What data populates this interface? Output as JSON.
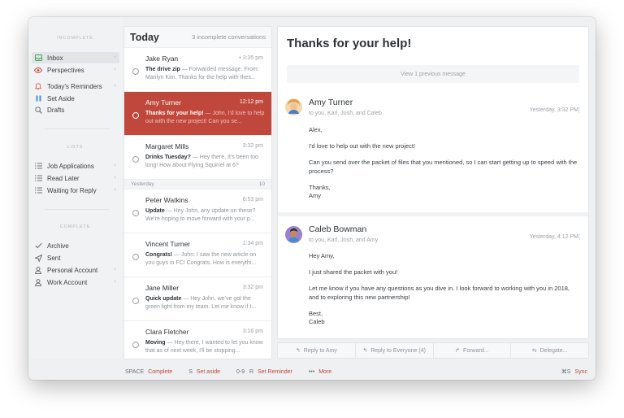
{
  "sidebar": {
    "sections": [
      "INCOMPLETE",
      "LISTS",
      "COMPLETE"
    ],
    "incomplete": [
      {
        "label": "Inbox",
        "icon": "inbox-icon",
        "color": "#45a35a"
      },
      {
        "label": "Perspectives",
        "icon": "eye-icon",
        "color": "#c0473b"
      },
      {
        "label": "Today's Reminders",
        "icon": "bell-icon",
        "color": "#e06a5c"
      },
      {
        "label": "Set Aside",
        "icon": "pause-icon",
        "color": "#4a8fd6"
      },
      {
        "label": "Drafts",
        "icon": "drafts-icon",
        "color": "#6b7076"
      }
    ],
    "lists": [
      {
        "label": "Job Applications",
        "icon": "list-icon"
      },
      {
        "label": "Read Later",
        "icon": "list-icon"
      },
      {
        "label": "Waiting for Reply",
        "icon": "list-icon"
      }
    ],
    "complete": [
      {
        "label": "Archive",
        "icon": "check-icon"
      },
      {
        "label": "Sent",
        "icon": "send-icon"
      },
      {
        "label": "Personal Account",
        "icon": "user-icon"
      },
      {
        "label": "Work Account",
        "icon": "user-icon"
      }
    ]
  },
  "list": {
    "title": "Today",
    "count_label": "3 incomplete conversations",
    "yesterday_label": "Yesterday",
    "yesterday_count": "10",
    "today": [
      {
        "sender": "Jake Ryan",
        "time": "3:35 pm",
        "subject": "The drive zip",
        "preview": " — Forwarded message. From: Marilyn Kim. Thanks for the help with thes..."
      },
      {
        "sender": "Amy Turner",
        "time": "12:12 pm",
        "subject": "Thanks for your help!",
        "preview": " — John, I'd love to help out with the new project! Can you se..."
      },
      {
        "sender": "Margaret Mills",
        "time": "3:32 pm",
        "subject": "Drinks Tuesday?",
        "preview": " — Hey there, It's been too long! How about Flying Squirrel at 6?"
      }
    ],
    "yesterday": [
      {
        "sender": "Peter Watkins",
        "time": "6:53 pm",
        "subject": "Update",
        "preview": " — Hey John, any update on these? We're hoping to move forward with your p..."
      },
      {
        "sender": "Vincent Turner",
        "time": "1:34 pm",
        "subject": "Congrats!",
        "preview": " — John: I saw the new article on you guys in FC! Congrats. How is everythi..."
      },
      {
        "sender": "Jane Miller",
        "time": "3:32 pm",
        "subject": "Quick update",
        "preview": " — Hey John, we've got the green light from my team. Let me know if I..."
      },
      {
        "sender": "Clara Fletcher",
        "time": "3:16 pm",
        "subject": "Moving",
        "preview": " — Hey there, I wanted to let you know that as of next week, I'll be stopping..."
      }
    ]
  },
  "pane": {
    "subject": "Thanks for your help!",
    "view_previous": "View 1 previous message",
    "messages": [
      {
        "name": "Amy Turner",
        "to": "to you, Karl, Josh, and Caleb",
        "time": "Yesterday, 3:32 PM",
        "body": [
          "Alex,",
          "I'd love to help out with the new project!",
          "Can you send over the packet of files that you mentioned, so I can start getting up to speed with the process?",
          "Thanks,\nAmy"
        ]
      },
      {
        "name": "Caleb Bowman",
        "to": "to you, Karl, Josh, and Amy",
        "time": "Yesterday, 4:12 PM",
        "body": [
          "Hey Amy,",
          "I just shared the packet with you!",
          "Let me know if you have any questions as you dive in. I look forward to working with you in 2018, and to exploring this new partnership!",
          "Best,\nCaleb"
        ]
      }
    ]
  },
  "actions": {
    "reply": "Reply to Amy",
    "reply_all": "Reply to Everyone (4)",
    "forward": "Forward...",
    "delegate": "Delegate..."
  },
  "bottom": {
    "shortcuts": [
      {
        "key": "SPACE",
        "action": "Complete"
      },
      {
        "key": "S",
        "action": "Set aside"
      },
      {
        "key": "0-9   R",
        "action": "Set Reminder"
      },
      {
        "key": "•••",
        "action": "More"
      }
    ],
    "sync_key": "⌘S",
    "sync_label": "Sync"
  },
  "colors": {
    "accent": "#c0473b",
    "selected_row": "#c0473b"
  }
}
